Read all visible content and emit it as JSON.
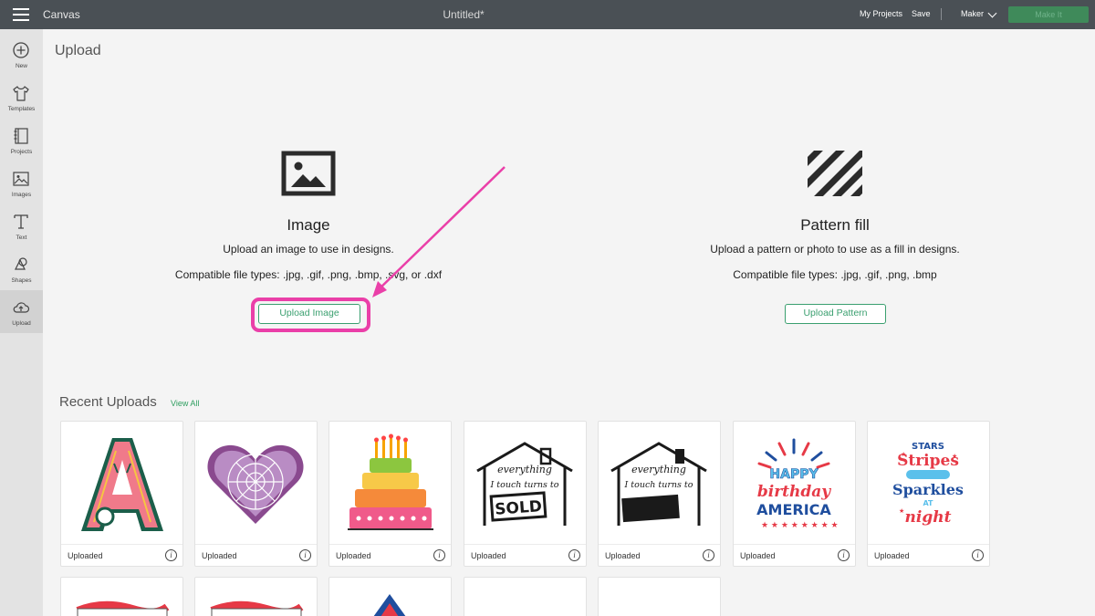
{
  "topbar": {
    "app_title": "Canvas",
    "doc_title": "Untitled*",
    "my_projects": "My Projects",
    "save": "Save",
    "machine": "Maker",
    "make_it": "Make It"
  },
  "sidebar": {
    "items": [
      {
        "label": "New",
        "icon": "plus-circle-icon"
      },
      {
        "label": "Templates",
        "icon": "tshirt-icon"
      },
      {
        "label": "Projects",
        "icon": "notebook-icon"
      },
      {
        "label": "Images",
        "icon": "image-icon"
      },
      {
        "label": "Text",
        "icon": "text-t-icon"
      },
      {
        "label": "Shapes",
        "icon": "shapes-icon"
      },
      {
        "label": "Upload",
        "icon": "cloud-upload-icon",
        "active": true
      }
    ]
  },
  "main": {
    "title": "Upload",
    "image_panel": {
      "heading": "Image",
      "description": "Upload an image to use in designs.",
      "file_types": "Compatible file types: .jpg, .gif, .png, .bmp, .svg, or .dxf",
      "button": "Upload Image"
    },
    "pattern_panel": {
      "heading": "Pattern fill",
      "description": "Upload a pattern or photo to use as a fill in designs.",
      "file_types": "Compatible file types: .jpg, .gif, .png, .bmp",
      "button": "Upload Pattern"
    },
    "recent": {
      "title": "Recent Uploads",
      "view_all": "View All",
      "items": [
        {
          "label": "Uploaded",
          "thumbnail": "letter-a-mandala"
        },
        {
          "label": "Uploaded",
          "thumbnail": "purple-mandala-heart"
        },
        {
          "label": "Uploaded",
          "thumbnail": "birthday-cake"
        },
        {
          "label": "Uploaded",
          "thumbnail": "house-sold-sign",
          "texts": [
            "everything",
            "I touch turns to",
            "SOLD"
          ]
        },
        {
          "label": "Uploaded",
          "thumbnail": "house-sign-blank",
          "texts": [
            "everything",
            "I touch turns to"
          ]
        },
        {
          "label": "Uploaded",
          "thumbnail": "happy-birthday-america",
          "texts": [
            "HAPPY",
            "birthday",
            "AMERICA"
          ]
        },
        {
          "label": "Uploaded",
          "thumbnail": "stars-stripes-sparkles",
          "texts": [
            "STARS",
            "Stripes",
            "Sparkles",
            "AT",
            "night"
          ]
        }
      ]
    }
  },
  "colors": {
    "topbar": "#4a5055",
    "accent_green": "#3a9f6f",
    "highlight_pink": "#ea3fa8"
  }
}
